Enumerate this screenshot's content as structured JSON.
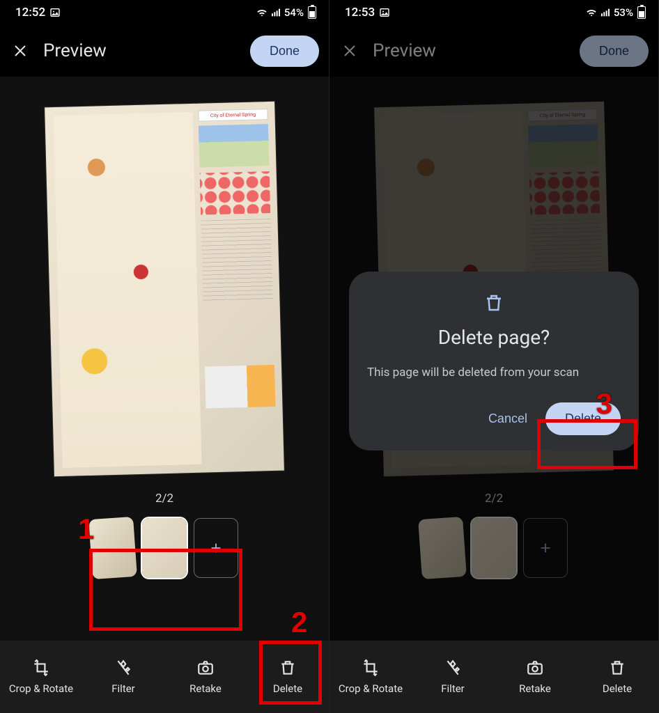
{
  "left": {
    "status": {
      "time": "12:52",
      "battery_pct": "54%"
    },
    "header": {
      "title": "Preview",
      "done": "Done"
    },
    "page_indicator": "2/2",
    "bottom": {
      "crop": "Crop & Rotate",
      "filter": "Filter",
      "retake": "Retake",
      "delete": "Delete"
    },
    "callouts": {
      "one": "1",
      "two": "2"
    },
    "scan_card_title": "City of Eternal Spring"
  },
  "right": {
    "status": {
      "time": "12:53",
      "battery_pct": "53%"
    },
    "header": {
      "title": "Preview",
      "done": "Done"
    },
    "page_indicator": "2/2",
    "bottom": {
      "crop": "Crop & Rotate",
      "filter": "Filter",
      "retake": "Retake",
      "delete": "Delete"
    },
    "dialog": {
      "title": "Delete page?",
      "body": "This page will be deleted from your scan",
      "cancel": "Cancel",
      "confirm": "Delete"
    },
    "callouts": {
      "three": "3"
    },
    "scan_card_title": "City of Eternal Spring"
  }
}
